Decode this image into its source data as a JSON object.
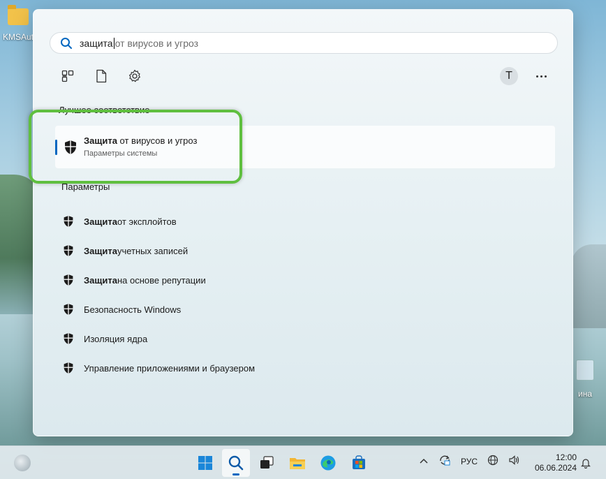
{
  "desktop": {
    "icons": [
      {
        "label": "KMSAut"
      },
      {
        "label": "ина"
      }
    ]
  },
  "search": {
    "typed": "защита",
    "suggestion": " от вирусов и угроз"
  },
  "filters": [
    {
      "icon": "apps-icon"
    },
    {
      "icon": "document-icon"
    },
    {
      "icon": "gear-icon"
    }
  ],
  "account": {
    "initial": "T"
  },
  "best_match": {
    "heading": "Лучшее соответствие",
    "title_bold": "Защита",
    "title_rest": " от вирусов и угроз",
    "subtitle": "Параметры системы"
  },
  "settings_section": {
    "heading": "Параметры",
    "items": [
      {
        "bold": "Защита",
        "rest": " от эксплойтов"
      },
      {
        "bold": "Защита",
        "rest": " учетных записей"
      },
      {
        "bold": "Защита",
        "rest": " на основе репутации"
      },
      {
        "bold": "",
        "rest": "Безопасность Windows"
      },
      {
        "bold": "",
        "rest": "Изоляция ядра"
      },
      {
        "bold": "",
        "rest": "Управление приложениями и браузером"
      }
    ]
  },
  "taskbar": {
    "apps": [
      "windows-start",
      "search",
      "task-view",
      "file-explorer",
      "edge",
      "store"
    ],
    "language": "РУС",
    "time": "12:00",
    "date": "06.06.2024"
  },
  "colors": {
    "accent": "#0067c0",
    "highlight": "#5fbf3f"
  }
}
